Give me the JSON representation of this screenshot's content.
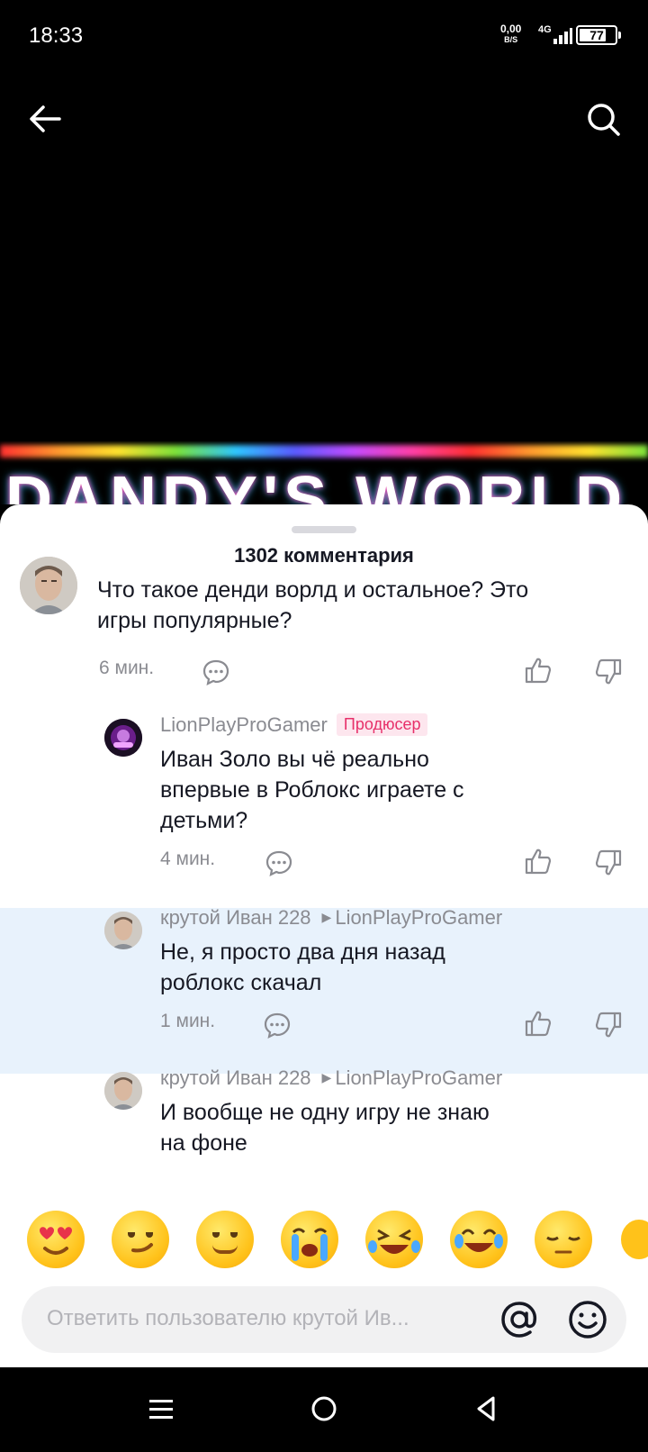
{
  "status_bar": {
    "time": "18:33",
    "net_speed": "0,00",
    "net_unit": "B/S",
    "net_type": "4G",
    "battery": "77",
    "battery_level": 0.77
  },
  "header": {
    "back_icon": "back-arrow-icon",
    "search_icon": "search-icon"
  },
  "video": {
    "overlay_text": "DANDY'S WORLD"
  },
  "comments_sheet": {
    "count_label": "1302 комментария",
    "comments": [
      {
        "author": "",
        "text_line1": "Что такое денди ворлд и остальное? Это",
        "text_line2": "игры популярные?",
        "time": "6 мин."
      },
      {
        "author": "LionPlayProGamer",
        "badge": "Продюсер",
        "text_line1": "Иван Золо вы чё реально",
        "text_line2": "впервые в Роблокс играете с",
        "text_line3": "детьми?",
        "time": "4 мин."
      },
      {
        "author": "крутой Иван 228",
        "reply_to": "LionPlayProGamer",
        "text_line1": "Не, я просто два дня назад",
        "text_line2": "роблокс скачал",
        "time": "1 мин."
      },
      {
        "author": "крутой Иван 228",
        "reply_to": "LionPlayProGamer",
        "text_line1": "И вообще не одну игру не знаю",
        "text_line2": "на фоне"
      }
    ]
  },
  "emoji_bar": [
    "heart-eyes-emoji",
    "smirk-emoji",
    "blush-emoji",
    "crying-emoji",
    "rofl-emoji",
    "joy-emoji",
    "pensive-emoji"
  ],
  "reply_input": {
    "placeholder": "Ответить пользователю крутой Ив..."
  },
  "colors": {
    "accent_badge": "#e7306a",
    "highlight": "#e8f2fc",
    "muted_text": "#8a8b91"
  }
}
